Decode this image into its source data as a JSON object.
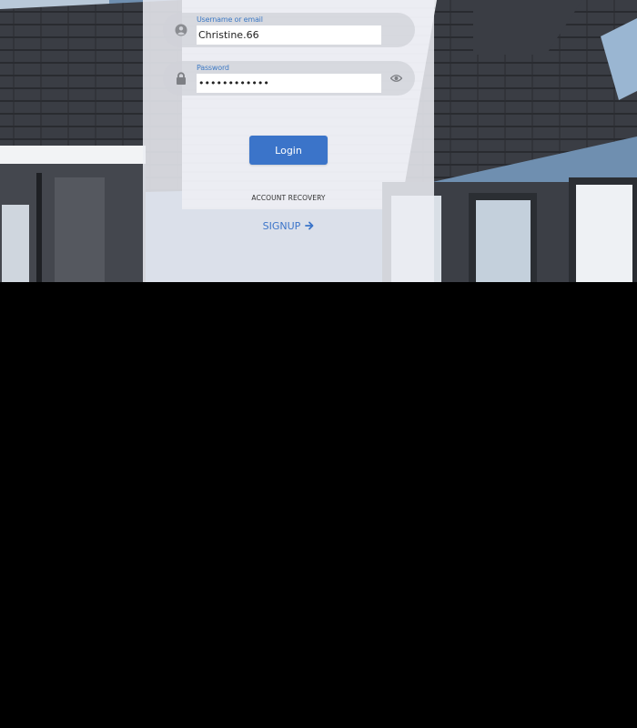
{
  "form": {
    "username": {
      "label": "Username or email",
      "value": "Christine.66",
      "icon": "user-circle-icon"
    },
    "password": {
      "label": "Password",
      "value": "••••••••••••",
      "icon": "lock-icon",
      "toggle_icon": "eye-icon"
    },
    "login_label": "Login",
    "recovery_label": "ACCOUNT RECOVERY",
    "signup_label": "SIGNUP",
    "signup_icon": "arrow-right-icon"
  },
  "colors": {
    "accent": "#3b74c9",
    "panel": "#eceef3",
    "field": "#d0d2d8",
    "below_page": "#000000"
  }
}
